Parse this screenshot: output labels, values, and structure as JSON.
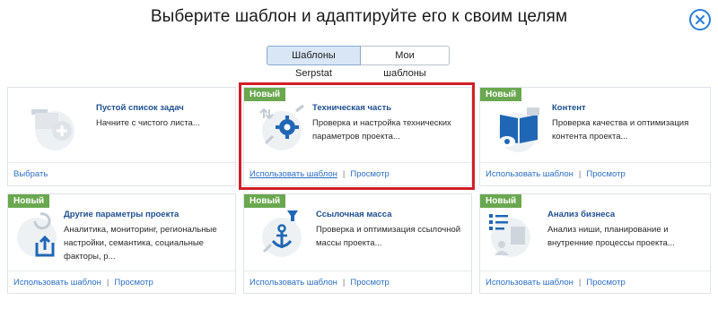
{
  "header": {
    "title": "Выберите шаблон и адаптируйте его к своим целям"
  },
  "tabs": [
    {
      "label": "Шаблоны Serpstat"
    },
    {
      "label": "Мои шаблоны"
    }
  ],
  "badge_new": "Новый",
  "cards": [
    {
      "title": "Пустой список задач",
      "desc": "Начните с чистого листа...",
      "action": "Выбрать"
    },
    {
      "title": "Техническая часть",
      "desc": "Проверка и настройка технических параметров проекта...",
      "action": "Использовать шаблон",
      "preview": "Просмотр"
    },
    {
      "title": "Контент",
      "desc": "Проверка качества и оптимизация контента проекта...",
      "action": "Использовать шаблон",
      "preview": "Просмотр"
    },
    {
      "title": "Другие параметры проекта",
      "desc": "Аналитика, мониторинг, региональные настройки, семантика, социальные факторы, р...",
      "action": "Использовать шаблон",
      "preview": "Просмотр"
    },
    {
      "title": "Ссылочная масса",
      "desc": "Проверка и оптимизация ссылочной массы проекта...",
      "action": "Использовать шаблон",
      "preview": "Просмотр"
    },
    {
      "title": "Анализ бизнеса",
      "desc": "Анализ ниши, планирование и внутренние процессы проекта...",
      "action": "Использовать шаблон",
      "preview": "Просмотр"
    }
  ],
  "colors": {
    "accent": "#2a7ddb",
    "badge": "#6aa84f",
    "highlight": "#d21f28",
    "icon_blue": "#1f67b5"
  }
}
